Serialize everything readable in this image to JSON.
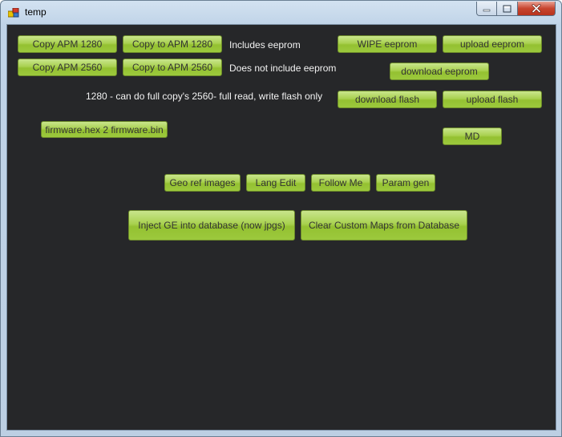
{
  "window": {
    "title": "temp"
  },
  "buttons": {
    "copy_apm_1280": "Copy APM 1280",
    "copy_to_apm_1280": "Copy to APM 1280",
    "copy_apm_2560": "Copy APM 2560",
    "copy_to_apm_2560": "Copy to APM 2560",
    "wipe_eeprom": "WIPE eeprom",
    "upload_eeprom": "upload eeprom",
    "download_eeprom": "download eeprom",
    "download_flash": "download flash",
    "upload_flash": "upload flash",
    "firmware_hex_2_bin": "firmware.hex 2 firmware.bin",
    "md": "MD",
    "geo_ref_images": "Geo ref images",
    "lang_edit": "Lang Edit",
    "follow_me": "Follow Me",
    "param_gen": "Param gen",
    "inject_ge": "Inject GE into database (now jpgs)",
    "clear_custom_maps": "Clear Custom Maps from Database"
  },
  "labels": {
    "includes_eeprom": "Includes eeprom",
    "does_not_include_eeprom": "Does not include eeprom",
    "capabilities_note": "1280 - can do full copy's   2560- full read, write flash only"
  },
  "icons": {
    "app": "app-icon",
    "minimize": "minimize-icon",
    "maximize": "maximize-icon",
    "close": "close-icon"
  },
  "colors": {
    "client_bg": "#262729",
    "button_green": "#a9d150",
    "label_text": "#f2f2f2"
  }
}
